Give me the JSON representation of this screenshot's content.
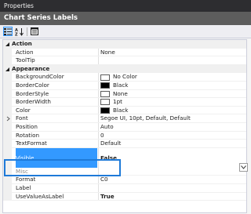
{
  "window": {
    "title": "Properties"
  },
  "object": {
    "name": "Chart Series Labels"
  },
  "toolbar": {
    "categorized_icon": "categorized-icon",
    "alphabetical_icon": "alphabetical-icon",
    "property_pages_icon": "property-pages-icon"
  },
  "colors": {
    "accent": "#3399ff",
    "highlight_border": "#1e7ad8",
    "selection": "#3399ff",
    "title_bar": "#2d2d30",
    "object_bar": "#5d5d5d"
  },
  "grid": {
    "category_action": "Action",
    "action": {
      "label": "Action",
      "value": "None"
    },
    "tooltip": {
      "label": "ToolTip",
      "value": ""
    },
    "category_appearance": "Appearance",
    "background_color": {
      "label": "BackgroundColor",
      "value": "No Color",
      "swatch": "#ffffff"
    },
    "border_color": {
      "label": "BorderColor",
      "value": "Black",
      "swatch": "#000000"
    },
    "border_style": {
      "label": "BorderStyle",
      "value": "None",
      "swatch": "#ffffff"
    },
    "border_width": {
      "label": "BorderWidth",
      "value": "1pt",
      "swatch": "#ffffff"
    },
    "color": {
      "label": "Color",
      "value": "Black",
      "swatch": "#000000"
    },
    "font": {
      "label": "Font",
      "value": "Segoe UI, 10pt, Default, Default"
    },
    "position": {
      "label": "Position",
      "value": "Auto"
    },
    "rotation": {
      "label": "Rotation",
      "value": "0"
    },
    "text_format": {
      "label": "TextFormat",
      "value": "Default"
    },
    "visible": {
      "label": "Visible",
      "value": "False"
    },
    "hidden_row": {
      "label": "Misc",
      "value": ""
    },
    "format": {
      "label": "Format",
      "value": "C0"
    },
    "label": {
      "label": "Label",
      "value": ""
    },
    "use_value_as_label": {
      "label": "UseValueAsLabel",
      "value": "True"
    }
  }
}
